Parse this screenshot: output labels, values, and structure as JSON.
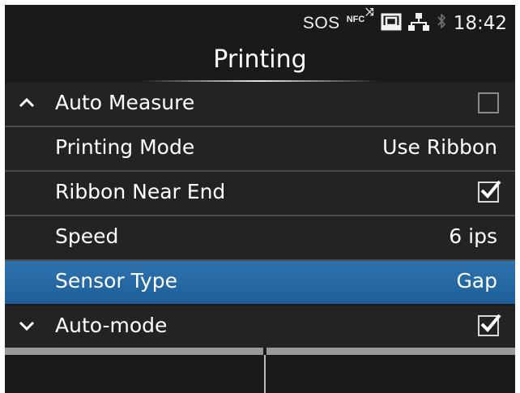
{
  "status": {
    "sos": "SOS",
    "nfc": "NFC",
    "clock": "18:42",
    "icons": [
      "nfc-icon",
      "sd-card-icon",
      "network-icon",
      "bluetooth-icon"
    ]
  },
  "title": "Printing",
  "menu": {
    "items": [
      {
        "label": "Auto Measure",
        "indicator": "chevron-up-icon",
        "control": "checkbox",
        "checked": false
      },
      {
        "label": "Printing Mode",
        "value": "Use Ribbon"
      },
      {
        "label": "Ribbon Near End",
        "control": "checkbox",
        "checked": true
      },
      {
        "label": "Speed",
        "value": "6 ips"
      },
      {
        "label": "Sensor Type",
        "value": "Gap",
        "selected": true
      },
      {
        "label": "Auto-mode",
        "indicator": "chevron-down-icon",
        "control": "checkbox",
        "checked": true
      }
    ]
  },
  "softkeys": {
    "left": "",
    "right": ""
  },
  "colors": {
    "background": "#1a1a1a",
    "row": "#232323",
    "selected": "#2e72ad",
    "text": "#ffffff"
  }
}
